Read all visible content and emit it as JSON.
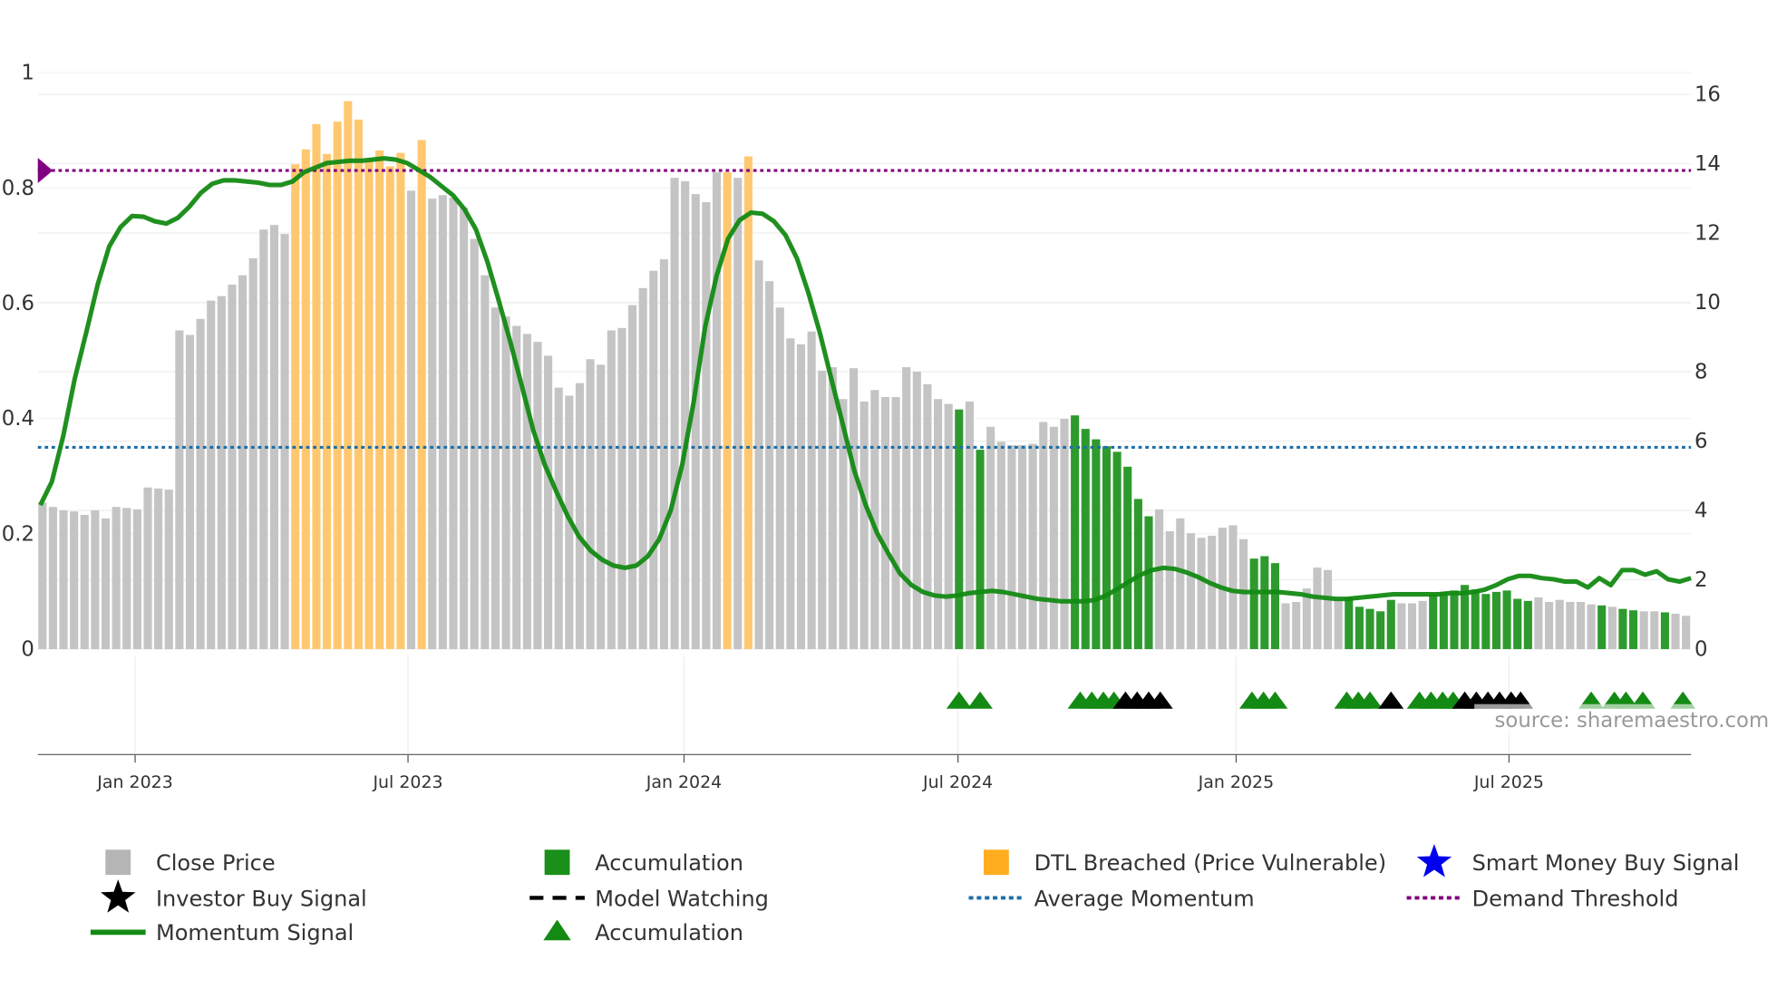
{
  "chart_data": {
    "type": "bar",
    "title": "",
    "colors": {
      "close": "#c4c4c4",
      "accumulation": "#2e9a2e",
      "dtl": "#ffc870",
      "momentum": "#138a13",
      "avg": "#1f6fa8",
      "threshold": "#800080",
      "triangle_green": "#138a13",
      "triangle_black": "#000000"
    },
    "left_axis": {
      "range": [
        0,
        1
      ],
      "ticks": [
        {
          "v": 0,
          "label": "0"
        },
        {
          "v": 0.2,
          "label": "0.2"
        },
        {
          "v": 0.4,
          "label": "0.4"
        },
        {
          "v": 0.6,
          "label": "0.6"
        },
        {
          "v": 0.8,
          "label": "0.8"
        },
        {
          "v": 1,
          "label": "1"
        }
      ]
    },
    "right_axis": {
      "range": [
        0,
        16
      ],
      "ticks": [
        {
          "v": 0,
          "label": "0"
        },
        {
          "v": 2,
          "label": "2"
        },
        {
          "v": 4,
          "label": "4"
        },
        {
          "v": 6,
          "label": "6"
        },
        {
          "v": 8,
          "label": "8"
        },
        {
          "v": 10,
          "label": "10"
        },
        {
          "v": 12,
          "label": "12"
        },
        {
          "v": 14,
          "label": "14"
        },
        {
          "v": 16,
          "label": "16"
        }
      ]
    },
    "x_ticks": [
      {
        "week": 8.8,
        "label": "Jan 2023"
      },
      {
        "week": 34.7,
        "label": "Jul 2023"
      },
      {
        "week": 60.9,
        "label": "Jan 2024"
      },
      {
        "week": 86.9,
        "label": "Jul 2024"
      },
      {
        "week": 113.3,
        "label": "Jan 2025"
      },
      {
        "week": 139.2,
        "label": "Jul 2025"
      }
    ],
    "price": [
      4.23,
      4.1,
      4.0,
      3.97,
      3.87,
      4.0,
      3.77,
      4.1,
      4.07,
      4.03,
      4.66,
      4.63,
      4.6,
      9.19,
      9.06,
      9.52,
      10.05,
      10.18,
      10.51,
      10.78,
      11.27,
      12.1,
      12.23,
      11.97,
      13.98,
      14.41,
      15.14,
      14.28,
      15.21,
      15.8,
      15.27,
      14.08,
      14.38,
      13.92,
      14.31,
      13.22,
      14.68,
      12.99,
      13.09,
      13.02,
      12.73,
      11.83,
      10.78,
      9.85,
      9.59,
      9.32,
      9.09,
      8.86,
      8.46,
      7.54,
      7.31,
      7.67,
      8.36,
      8.2,
      9.19,
      9.26,
      9.92,
      10.41,
      10.91,
      11.24,
      13.59,
      13.49,
      13.12,
      12.89,
      13.75,
      13.75,
      13.59,
      14.21,
      11.21,
      10.61,
      9.85,
      8.96,
      8.79,
      9.16,
      8.03,
      8.13,
      7.21,
      8.1,
      7.14,
      7.47,
      7.27,
      7.27,
      8.13,
      8.0,
      7.64,
      7.21,
      7.07,
      6.91,
      7.14,
      5.75,
      6.41,
      5.98,
      5.88,
      5.88,
      5.92,
      6.55,
      6.41,
      6.64,
      6.74,
      6.35,
      6.05,
      5.85,
      5.69,
      5.26,
      4.33,
      3.83,
      4.03,
      3.4,
      3.77,
      3.34,
      3.21,
      3.27,
      3.5,
      3.57,
      3.17,
      2.61,
      2.68,
      2.48,
      1.32,
      1.36,
      1.75,
      2.35,
      2.28,
      1.45,
      1.49,
      1.22,
      1.16,
      1.09,
      1.42,
      1.32,
      1.32,
      1.39,
      1.59,
      1.65,
      1.69,
      1.85,
      1.72,
      1.59,
      1.65,
      1.69,
      1.45,
      1.39,
      1.49,
      1.36,
      1.42,
      1.36,
      1.36,
      1.29,
      1.26,
      1.22,
      1.16,
      1.12,
      1.09,
      1.09,
      1.06,
      1.02,
      0.96
    ],
    "price_state": "ggggggggggggggggggggggggdddddddddddgdggggggggggggggggggggggggggggdgdgggggggggggggggggggagaggggggggaaaaaaaagggggggggaaaggggggaaaaagggaaaaaaaaaaggggggagaaggaggga",
    "momentum": {
      "start_week": -0.2,
      "step_weeks": 1.088,
      "values": [
        0.25,
        0.29,
        0.37,
        0.469,
        0.549,
        0.632,
        0.698,
        0.732,
        0.751,
        0.75,
        0.742,
        0.738,
        0.748,
        0.767,
        0.791,
        0.807,
        0.813,
        0.813,
        0.811,
        0.809,
        0.805,
        0.805,
        0.811,
        0.827,
        0.835,
        0.843,
        0.845,
        0.847,
        0.847,
        0.849,
        0.851,
        0.849,
        0.843,
        0.831,
        0.819,
        0.803,
        0.787,
        0.763,
        0.728,
        0.672,
        0.604,
        0.533,
        0.457,
        0.38,
        0.32,
        0.274,
        0.231,
        0.195,
        0.171,
        0.155,
        0.145,
        0.141,
        0.145,
        0.161,
        0.191,
        0.241,
        0.32,
        0.429,
        0.559,
        0.648,
        0.712,
        0.744,
        0.757,
        0.755,
        0.742,
        0.718,
        0.678,
        0.618,
        0.549,
        0.469,
        0.39,
        0.31,
        0.25,
        0.201,
        0.165,
        0.131,
        0.111,
        0.099,
        0.093,
        0.091,
        0.093,
        0.097,
        0.099,
        0.101,
        0.099,
        0.095,
        0.091,
        0.087,
        0.085,
        0.083,
        0.083,
        0.083,
        0.085,
        0.093,
        0.105,
        0.117,
        0.129,
        0.137,
        0.141,
        0.139,
        0.133,
        0.125,
        0.115,
        0.107,
        0.101,
        0.099,
        0.099,
        0.099,
        0.099,
        0.097,
        0.095,
        0.091,
        0.089,
        0.087,
        0.087,
        0.089,
        0.091,
        0.093,
        0.095,
        0.095,
        0.095,
        0.095,
        0.095,
        0.097,
        0.097,
        0.099,
        0.103,
        0.111,
        0.121,
        0.127,
        0.127,
        0.123,
        0.121,
        0.117,
        0.117,
        0.107,
        0.123,
        0.111,
        0.137,
        0.137,
        0.129,
        0.135,
        0.121,
        0.117,
        0.123
      ]
    },
    "average_momentum": 0.35,
    "demand_threshold": 0.83,
    "signals": [
      {
        "week": 87,
        "type": "accumulation"
      },
      {
        "week": 89,
        "type": "accumulation"
      },
      {
        "week": 98.5,
        "type": "accumulation"
      },
      {
        "week": 99.6,
        "type": "accumulation"
      },
      {
        "week": 100.7,
        "type": "accumulation"
      },
      {
        "week": 101.7,
        "type": "accumulation"
      },
      {
        "week": 102.8,
        "type": "investor"
      },
      {
        "week": 103.9,
        "type": "investor"
      },
      {
        "week": 105,
        "type": "investor"
      },
      {
        "week": 106.1,
        "type": "investor"
      },
      {
        "week": 114.8,
        "type": "accumulation"
      },
      {
        "week": 115.9,
        "type": "accumulation"
      },
      {
        "week": 117,
        "type": "accumulation"
      },
      {
        "week": 123.8,
        "type": "accumulation"
      },
      {
        "week": 124.9,
        "type": "accumulation"
      },
      {
        "week": 126,
        "type": "accumulation"
      },
      {
        "week": 128,
        "type": "investor"
      },
      {
        "week": 130.7,
        "type": "accumulation"
      },
      {
        "week": 131.8,
        "type": "accumulation"
      },
      {
        "week": 132.9,
        "type": "accumulation"
      },
      {
        "week": 133.9,
        "type": "accumulation"
      },
      {
        "week": 135,
        "type": "investor"
      },
      {
        "week": 136.1,
        "type": "investor"
      },
      {
        "week": 137.2,
        "type": "investor"
      },
      {
        "week": 138.3,
        "type": "investor"
      },
      {
        "week": 139.4,
        "type": "investor"
      },
      {
        "week": 140.3,
        "type": "investor"
      },
      {
        "week": 147,
        "type": "accumulation"
      },
      {
        "week": 149.2,
        "type": "accumulation"
      },
      {
        "week": 150.3,
        "type": "accumulation"
      },
      {
        "week": 151.9,
        "type": "accumulation"
      },
      {
        "week": 155.7,
        "type": "accumulation"
      }
    ],
    "source": "source: sharemaestro.com",
    "legend": [
      {
        "label": "Close Price",
        "icon": "square",
        "color": "#b5b5b5"
      },
      {
        "label": "Accumulation",
        "icon": "square",
        "color": "#1a8f1a"
      },
      {
        "label": "DTL Breached (Price Vulnerable)",
        "icon": "square",
        "color": "#ffad1f"
      },
      {
        "label": "Smart Money Buy Signal",
        "icon": "star",
        "color": "#0000ee"
      },
      {
        "label": "Investor Buy Signal",
        "icon": "star",
        "color": "#000000"
      },
      {
        "label": "Model Watching",
        "icon": "dash",
        "color": "#000000"
      },
      {
        "label": "Average Momentum",
        "icon": "dot",
        "color": "#1f6fa8"
      },
      {
        "label": "Demand Threshold",
        "icon": "dot",
        "color": "#800080"
      },
      {
        "label": "Momentum Signal",
        "icon": "line",
        "color": "#138a13"
      },
      {
        "label": "Accumulation",
        "icon": "triangle",
        "color": "#138a13"
      }
    ]
  }
}
